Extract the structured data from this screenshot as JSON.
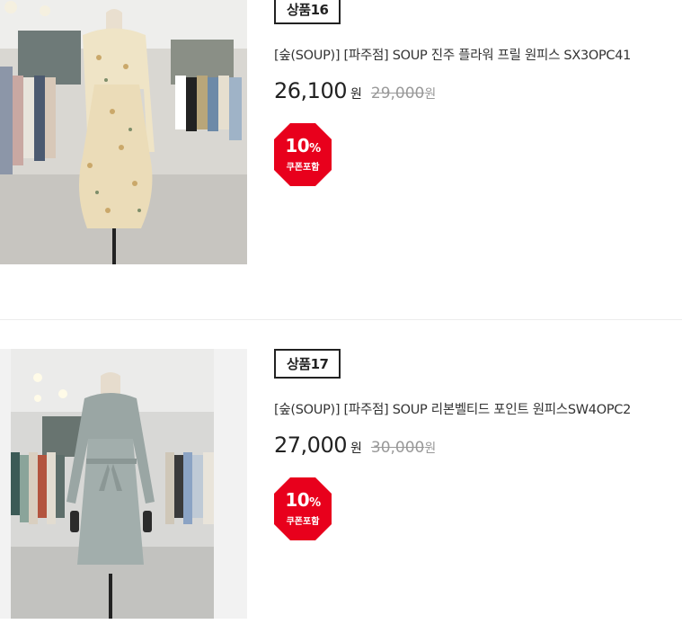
{
  "products": [
    {
      "badge": "상품16",
      "title": "[숲(SOUP)] [파주점] SOUP 진주 플라워 프릴 원피스 SX3OPC41",
      "price": "26,100",
      "currency": "원",
      "original_price": "29,000",
      "original_currency": "원",
      "coupon_percent": "10",
      "coupon_percent_sign": "%",
      "coupon_label": "쿠폰포함",
      "image": "floral-dress-photo"
    },
    {
      "badge": "상품17",
      "title": "[숲(SOUP)] [파주점] SOUP 리본벨티드 포인트 원피스SW4OPC2",
      "price": "27,000",
      "currency": "원",
      "original_price": "30,000",
      "original_currency": "원",
      "coupon_percent": "10",
      "coupon_percent_sign": "%",
      "coupon_label": "쿠폰포함",
      "image": "gray-belted-dress-photo"
    }
  ],
  "colors": {
    "coupon_red": "#e8001c",
    "text": "#222222",
    "muted": "#999999"
  }
}
